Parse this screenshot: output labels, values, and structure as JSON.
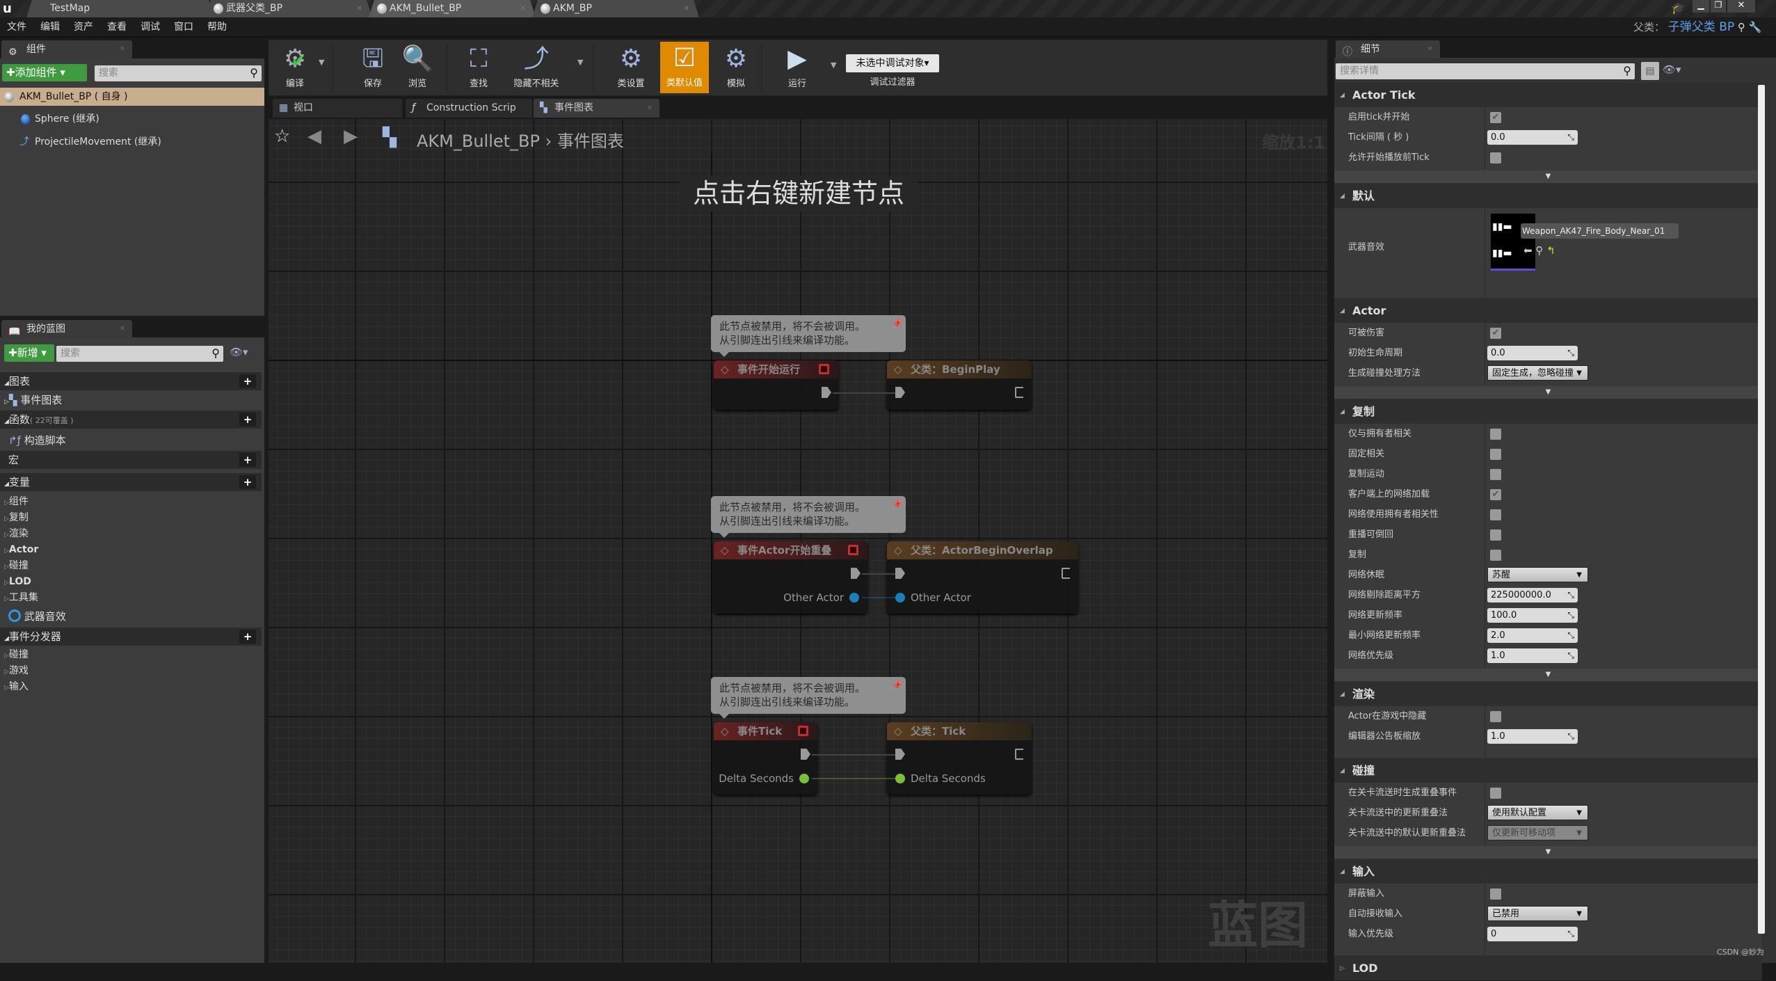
{
  "titlebar": {
    "tabs": [
      {
        "label": "TestMap"
      },
      {
        "label": "武器父类_BP"
      },
      {
        "label": "AKM_Bullet_BP"
      },
      {
        "label": "AKM_BP"
      }
    ]
  },
  "menu": [
    "文件",
    "编辑",
    "资产",
    "查看",
    "调试",
    "窗口",
    "帮助"
  ],
  "parent_class": {
    "label": "父类：",
    "value": "子弹父类 BP"
  },
  "components": {
    "tab": "组件",
    "add_button": "添加组件",
    "search_placeholder": "搜索",
    "items": [
      {
        "label": "AKM_Bullet_BP ( 自身 )",
        "icon": "sphere-icon"
      },
      {
        "label": "Sphere (继承)",
        "icon": "sphere-icon"
      },
      {
        "label": "ProjectileMovement (继承)",
        "icon": "movement-icon"
      }
    ]
  },
  "my_blueprint": {
    "tab": "我的蓝图",
    "new_button": "新增",
    "search_placeholder": "搜索",
    "graphs": {
      "label": "图表",
      "items": [
        "事件图表"
      ]
    },
    "functions": {
      "label": "函数",
      "note": "( 22可覆盖 )",
      "items": [
        "构造脚本"
      ]
    },
    "macros": {
      "label": "宏"
    },
    "variables": {
      "label": "变量",
      "categories": [
        "组件",
        "复制",
        "渲染",
        "Actor",
        "碰撞",
        "LOD",
        "工具集"
      ],
      "items": [
        "武器音效"
      ]
    },
    "dispatchers": {
      "label": "事件分发器",
      "categories": [
        "碰撞",
        "游戏",
        "输入"
      ]
    }
  },
  "toolbar": {
    "buttons": [
      "编译",
      "保存",
      "浏览",
      "查找",
      "隐藏不相关",
      "类设置",
      "类默认值",
      "模拟",
      "运行"
    ],
    "debug_object": "未选中调试对象",
    "debug_filter": "调试过滤器",
    "active": "类默认值"
  },
  "graph_tabs": [
    {
      "label": "视口"
    },
    {
      "label": "Construction Scrip"
    },
    {
      "label": "事件图表"
    }
  ],
  "breadcrumb": {
    "blueprint": "AKM_Bullet_BP",
    "separator": "›",
    "graph": "事件图表"
  },
  "zoom_label": "缩放1:1",
  "hint": "点击右键新建节点",
  "watermark": "蓝图",
  "disabled_comment": [
    "此节点被禁用，将不会被调用。",
    "从引脚连出引线来编译功能。"
  ],
  "nodes": [
    {
      "title": "事件开始运行",
      "type": "event",
      "pins_out": []
    },
    {
      "title": "父类：BeginPlay",
      "type": "parent",
      "pins_in": []
    },
    {
      "title": "事件Actor开始重叠",
      "type": "event",
      "pins_out": [
        "Other Actor"
      ]
    },
    {
      "title": "父类：ActorBeginOverlap",
      "type": "parent",
      "pins_in": [
        "Other Actor"
      ]
    },
    {
      "title": "事件Tick",
      "type": "event",
      "pins_out": [
        "Delta Seconds"
      ]
    },
    {
      "title": "父类：Tick",
      "type": "parent",
      "pins_in": [
        "Delta Seconds"
      ]
    }
  ],
  "details": {
    "tab": "细节",
    "search_placeholder": "搜索详情",
    "sections": [
      {
        "title": "Actor Tick",
        "rows": [
          {
            "label": "启用tick并开始",
            "type": "check",
            "value": true
          },
          {
            "label": "Tick间隔 ( 秒 )",
            "type": "num",
            "value": "0.0"
          },
          {
            "label": "允许开始播放前Tick",
            "type": "check",
            "value": false
          }
        ],
        "expander": true
      },
      {
        "title": "默认",
        "rows": [
          {
            "label": "武器音效",
            "type": "asset",
            "value": "Weapon_AK47_Fire_Body_Near_01"
          }
        ],
        "expander": false
      },
      {
        "title": "Actor",
        "rows": [
          {
            "label": "可被伤害",
            "type": "check",
            "value": true
          },
          {
            "label": "初始生命周期",
            "type": "num",
            "value": "0.0"
          },
          {
            "label": "生成碰撞处理方法",
            "type": "dd",
            "value": "固定生成，忽略碰撞"
          }
        ],
        "expander": true
      },
      {
        "title": "复制",
        "rows": [
          {
            "label": "仅与拥有者相关",
            "type": "check",
            "value": false
          },
          {
            "label": "固定相关",
            "type": "check",
            "value": false
          },
          {
            "label": "复制运动",
            "type": "check",
            "value": false
          },
          {
            "label": "客户端上的网络加载",
            "type": "check",
            "value": true
          },
          {
            "label": "网络使用拥有者相关性",
            "type": "check",
            "value": false
          },
          {
            "label": "重播可倒回",
            "type": "check",
            "value": false
          },
          {
            "label": "复制",
            "type": "check",
            "value": false
          },
          {
            "label": "网络休眠",
            "type": "dd",
            "value": "苏醒"
          },
          {
            "label": "网络剔除距离平方",
            "type": "num",
            "value": "225000000.0"
          },
          {
            "label": "网络更新频率",
            "type": "num",
            "value": "100.0"
          },
          {
            "label": "最小网络更新频率",
            "type": "num",
            "value": "2.0"
          },
          {
            "label": "网络优先级",
            "type": "num",
            "value": "1.0"
          }
        ],
        "expander": true
      },
      {
        "title": "渲染",
        "rows": [
          {
            "label": "Actor在游戏中隐藏",
            "type": "check",
            "value": false
          },
          {
            "label": "编辑器公告板缩放",
            "type": "num",
            "value": "1.0"
          }
        ],
        "expander": false
      },
      {
        "title": "碰撞",
        "rows": [
          {
            "label": "在关卡流送时生成重叠事件",
            "type": "check",
            "value": false
          },
          {
            "label": "关卡流送中的更新重叠法",
            "type": "dd",
            "value": "使用默认配置"
          },
          {
            "label": "关卡流送中的默认更新重叠法",
            "type": "dd-disabled",
            "value": "仅更新可移动项"
          }
        ],
        "expander": true
      },
      {
        "title": "输入",
        "rows": [
          {
            "label": "屏蔽输入",
            "type": "check",
            "value": false
          },
          {
            "label": "自动接收输入",
            "type": "dd",
            "value": "已禁用"
          },
          {
            "label": "输入优先级",
            "type": "num",
            "value": "0"
          }
        ],
        "expander": false
      },
      {
        "title": "LOD",
        "rows": [],
        "expander": false,
        "collapsed": true
      }
    ]
  },
  "footer_watermark": "CSDN @妙为",
  "colors": {
    "active_button": "#e08a00",
    "add_green": "#3f9b3f",
    "parent_class": "#5aa0e8",
    "exec_event_header": "#6a2222",
    "object_pin": "#1d7fb8",
    "float_pin": "#7ac13a"
  }
}
